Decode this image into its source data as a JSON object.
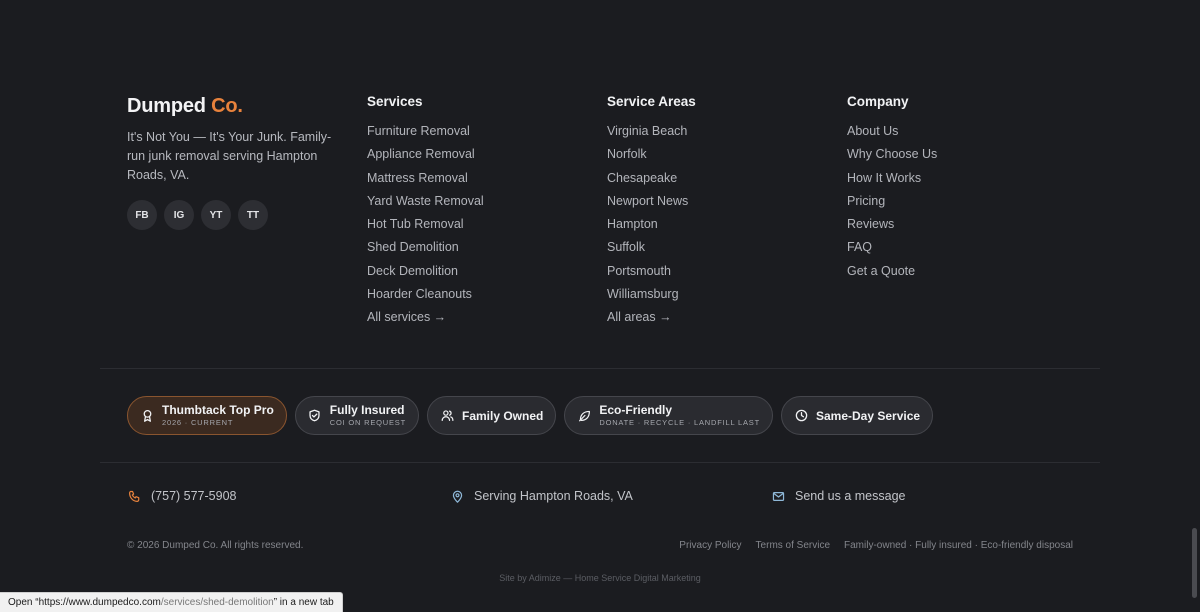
{
  "brand": {
    "name_main": "Dumped",
    "name_accent": "Co.",
    "tagline": "It's Not You — It's Your Junk. Family-run junk removal serving Hampton Roads, VA.",
    "socials": [
      "FB",
      "IG",
      "YT",
      "TT"
    ],
    "accent_color": "#e8823c"
  },
  "services": {
    "title": "Services",
    "items": [
      "Furniture Removal",
      "Appliance Removal",
      "Mattress Removal",
      "Yard Waste Removal",
      "Hot Tub Removal",
      "Shed Demolition",
      "Deck Demolition",
      "Hoarder Cleanouts",
      "All services →"
    ]
  },
  "areas": {
    "title": "Service Areas",
    "items": [
      "Virginia Beach",
      "Norfolk",
      "Chesapeake",
      "Newport News",
      "Hampton",
      "Suffolk",
      "Portsmouth",
      "Williamsburg",
      "All areas →"
    ]
  },
  "company": {
    "title": "Company",
    "items": [
      "About Us",
      "Why Choose Us",
      "How It Works",
      "Pricing",
      "Reviews",
      "FAQ",
      "Get a Quote"
    ]
  },
  "badges": [
    {
      "icon": "award-icon",
      "title": "Thumbtack Top Pro",
      "sub": "2026 · CURRENT"
    },
    {
      "icon": "shield-icon",
      "title": "Fully Insured",
      "sub": "COI ON REQUEST"
    },
    {
      "icon": "users-icon",
      "title": "Family Owned",
      "sub": ""
    },
    {
      "icon": "leaf-icon",
      "title": "Eco-Friendly",
      "sub": "DONATE · RECYCLE · LANDFILL LAST"
    },
    {
      "icon": "clock-icon",
      "title": "Same-Day Service",
      "sub": ""
    }
  ],
  "contact": {
    "phone": "(757) 577-5908",
    "location": "Serving Hampton Roads, VA",
    "message": "Send us a message"
  },
  "bottom": {
    "copyright": "© 2026 Dumped Co. All rights reserved.",
    "privacy": "Privacy Policy",
    "terms": "Terms of Service",
    "values": "Family-owned · Fully insured · Eco-friendly disposal",
    "credit": "Site by Adimize — Home Service Digital Marketing"
  },
  "status": {
    "prefix": "Open “",
    "url_base": "https://www.dumpedco.com",
    "url_path": "/services/shed-demolition",
    "suffix": "” in a new tab"
  }
}
